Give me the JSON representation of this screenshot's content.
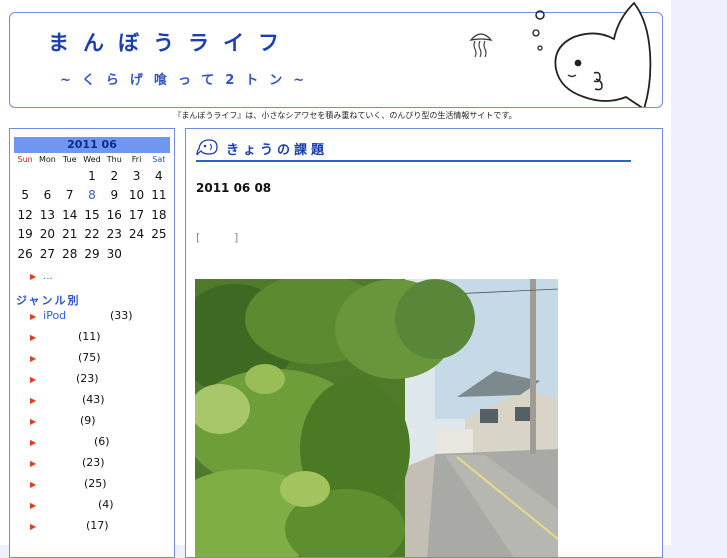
{
  "header": {
    "site_title": "まんぼうライフ",
    "subtitle": "~くらげ喰って2トン~",
    "tagline": "『まんぼうライフ』は、小さなシアワセを積み重ねていく、のんびり型の生活情報サイトです。"
  },
  "calendar": {
    "month_label": "2011 06",
    "weekdays": [
      "Sun",
      "Mon",
      "Tue",
      "Wed",
      "Thu",
      "Fri",
      "Sat"
    ],
    "weeks": [
      [
        "",
        "",
        "",
        "1",
        "2",
        "3",
        "4"
      ],
      [
        "5",
        "6",
        "7",
        "8",
        "9",
        "10",
        "11"
      ],
      [
        "12",
        "13",
        "14",
        "15",
        "16",
        "17",
        "18"
      ],
      [
        "19",
        "20",
        "21",
        "22",
        "23",
        "24",
        "25"
      ],
      [
        "26",
        "27",
        "28",
        "29",
        "30",
        "",
        ""
      ]
    ],
    "linked_day": "8"
  },
  "sidebar": {
    "more_link": "...",
    "genre_title": "ジャンル別",
    "genres": [
      {
        "name": "iPod",
        "count": "(33)"
      },
      {
        "name": "",
        "count": "(11)"
      },
      {
        "name": "",
        "count": "(75)"
      },
      {
        "name": "",
        "count": "(23)"
      },
      {
        "name": "",
        "count": "(43)"
      },
      {
        "name": "",
        "count": "(9)"
      },
      {
        "name": "",
        "count": "(6)"
      },
      {
        "name": "",
        "count": "(23)"
      },
      {
        "name": "",
        "count": "(25)"
      },
      {
        "name": "",
        "count": "(4)"
      },
      {
        "name": "",
        "count": "(17)"
      }
    ]
  },
  "main": {
    "category_title": "きょうの課題",
    "entry_date": "2011 06 08",
    "bracket_open": "[",
    "bracket_close": "]"
  }
}
